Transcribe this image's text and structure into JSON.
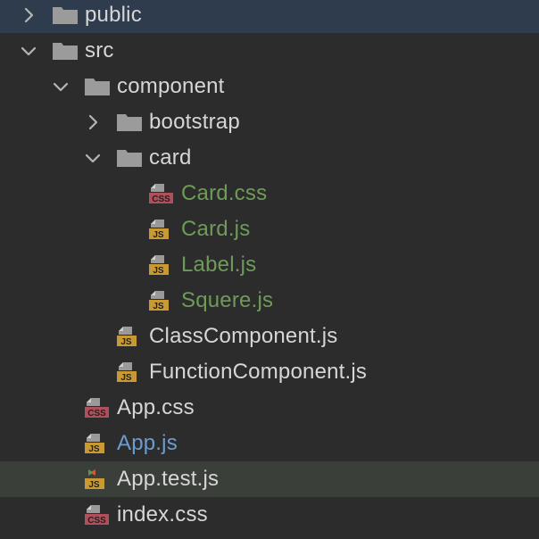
{
  "colors": {
    "text_default": "#d6d6d6",
    "text_added": "#6f9b5a",
    "text_modified": "#6d9ccf",
    "folder": "#9b9b9b",
    "css_badge": "#b0505c",
    "js_badge": "#c99a33"
  },
  "tree": [
    {
      "name": "public",
      "kind": "folder",
      "depth": 0,
      "expanded": false,
      "status": "default"
    },
    {
      "name": "src",
      "kind": "folder",
      "depth": 0,
      "expanded": true,
      "status": "default"
    },
    {
      "name": "component",
      "kind": "folder",
      "depth": 1,
      "expanded": true,
      "status": "default"
    },
    {
      "name": "bootstrap",
      "kind": "folder",
      "depth": 2,
      "expanded": false,
      "status": "default"
    },
    {
      "name": "card",
      "kind": "folder",
      "depth": 2,
      "expanded": true,
      "status": "default"
    },
    {
      "name": "Card.css",
      "kind": "css",
      "depth": 3,
      "status": "added"
    },
    {
      "name": "Card.js",
      "kind": "js",
      "depth": 3,
      "status": "added"
    },
    {
      "name": "Label.js",
      "kind": "js",
      "depth": 3,
      "status": "added"
    },
    {
      "name": "Squere.js",
      "kind": "js",
      "depth": 3,
      "status": "added"
    },
    {
      "name": "ClassComponent.js",
      "kind": "js",
      "depth": 2,
      "status": "default"
    },
    {
      "name": "FunctionComponent.js",
      "kind": "js",
      "depth": 2,
      "status": "default"
    },
    {
      "name": "App.css",
      "kind": "css",
      "depth": 1,
      "status": "default"
    },
    {
      "name": "App.js",
      "kind": "js",
      "depth": 1,
      "status": "modified"
    },
    {
      "name": "App.test.js",
      "kind": "jstest",
      "depth": 1,
      "status": "default"
    },
    {
      "name": "index.css",
      "kind": "css",
      "depth": 1,
      "status": "default"
    }
  ],
  "badges": {
    "css": "CSS",
    "js": "JS"
  },
  "icons": {
    "chevron_right": "chevron-right-icon",
    "chevron_down": "chevron-down-icon",
    "folder": "folder-icon",
    "css_file": "css-file-icon",
    "js_file": "js-file-icon",
    "js_test_file": "js-test-file-icon"
  }
}
